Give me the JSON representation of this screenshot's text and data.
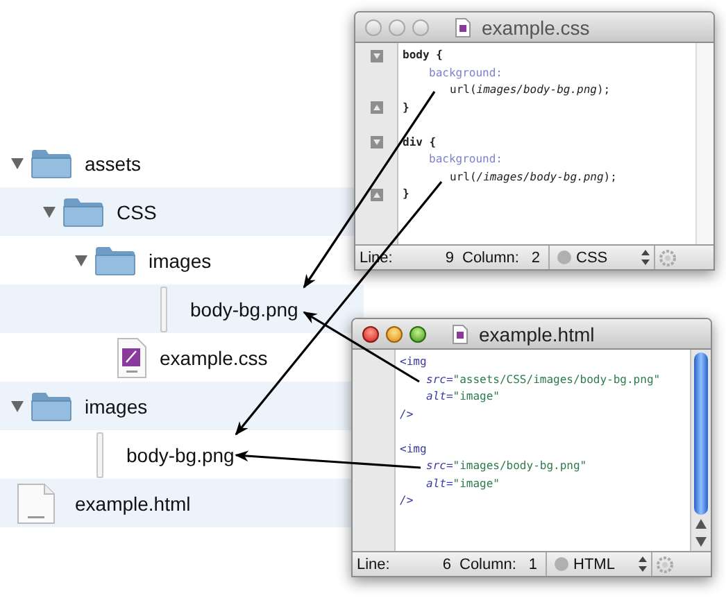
{
  "file_tree": [
    {
      "name": "assets",
      "kind": "folder",
      "expanded": true,
      "children": [
        {
          "name": "CSS",
          "kind": "folder",
          "expanded": true,
          "children": [
            {
              "name": "images",
              "kind": "folder",
              "expanded": true,
              "children": [
                {
                  "name": "body-bg.png",
                  "kind": "image"
                }
              ]
            },
            {
              "name": "example.css",
              "kind": "css"
            }
          ]
        }
      ]
    },
    {
      "name": "images",
      "kind": "folder",
      "expanded": true,
      "children": [
        {
          "name": "body-bg.png",
          "kind": "image"
        }
      ]
    },
    {
      "name": "example.html",
      "kind": "html"
    }
  ],
  "windows": [
    {
      "title": "example.css",
      "active": false,
      "scrollbar": false,
      "folding": true,
      "lines": [
        {
          "kind": "head",
          "tokens": [
            {
              "text": "body {",
              "kind": "selector"
            }
          ]
        },
        {
          "kind": "prop",
          "tokens": [
            {
              "text": "background:",
              "kind": "property"
            }
          ]
        },
        {
          "kind": "value",
          "tokens": [
            {
              "text": "url(",
              "kind": "plain"
            },
            {
              "text": "images/body-bg.png",
              "kind": "path"
            },
            {
              "text": ");",
              "kind": "plain"
            }
          ]
        },
        {
          "kind": "close",
          "tokens": [
            {
              "text": "}",
              "kind": "selector"
            }
          ]
        },
        {
          "kind": "blank"
        },
        {
          "kind": "head",
          "tokens": [
            {
              "text": "div {",
              "kind": "selector"
            }
          ]
        },
        {
          "kind": "prop",
          "tokens": [
            {
              "text": "background:",
              "kind": "property"
            }
          ]
        },
        {
          "kind": "value",
          "tokens": [
            {
              "text": "url(",
              "kind": "plain"
            },
            {
              "text": "/images/body-bg.png",
              "kind": "path"
            },
            {
              "text": ");",
              "kind": "plain"
            }
          ]
        },
        {
          "kind": "close",
          "tokens": [
            {
              "text": "}",
              "kind": "selector"
            }
          ]
        }
      ],
      "status": {
        "line_label": "Line:",
        "line": "9",
        "column_label": "Column:",
        "column": "2",
        "language": "CSS"
      }
    },
    {
      "title": "example.html",
      "active": true,
      "scrollbar": true,
      "folding": false,
      "lines": [
        {
          "kind": "head",
          "tokens": [
            {
              "text": "<img",
              "kind": "tag"
            }
          ]
        },
        {
          "kind": "prop",
          "tokens": [
            {
              "text": "src=",
              "kind": "attr"
            },
            {
              "text": "\"assets/CSS/images/body-bg.png\"",
              "kind": "string"
            }
          ]
        },
        {
          "kind": "prop",
          "tokens": [
            {
              "text": "alt=",
              "kind": "attr"
            },
            {
              "text": "\"image\"",
              "kind": "string"
            }
          ]
        },
        {
          "kind": "close",
          "tokens": [
            {
              "text": "/>",
              "kind": "attr"
            }
          ]
        },
        {
          "kind": "blank"
        },
        {
          "kind": "head",
          "tokens": [
            {
              "text": "<img",
              "kind": "tag"
            }
          ]
        },
        {
          "kind": "prop",
          "tokens": [
            {
              "text": "src=",
              "kind": "attr"
            },
            {
              "text": "\"images/body-bg.png\"",
              "kind": "string"
            }
          ]
        },
        {
          "kind": "prop",
          "tokens": [
            {
              "text": "alt=",
              "kind": "attr"
            },
            {
              "text": "\"image\"",
              "kind": "string"
            }
          ]
        },
        {
          "kind": "close",
          "tokens": [
            {
              "text": "/>",
              "kind": "attr"
            }
          ]
        }
      ],
      "status": {
        "line_label": "Line:",
        "line": "6",
        "column_label": "Column:",
        "column": "1",
        "language": "HTML"
      }
    }
  ]
}
